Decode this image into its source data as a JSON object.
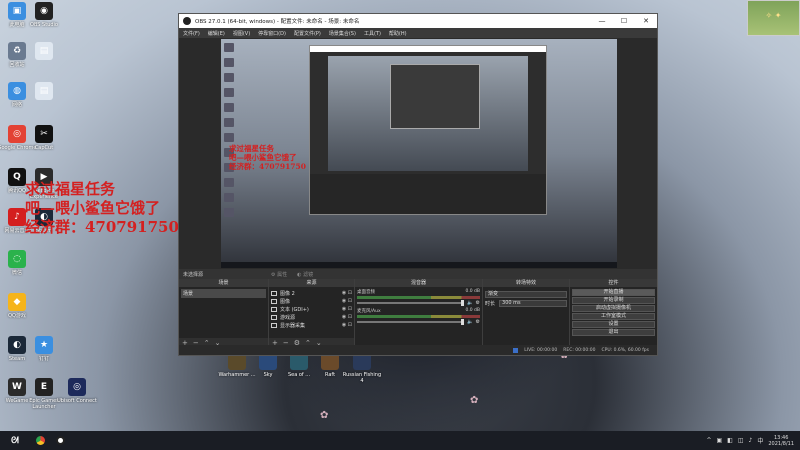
{
  "desktop": {
    "icons": [
      {
        "id": "this-pc",
        "label": "此电脑",
        "color": "#3b8fe0",
        "glyph": "▣"
      },
      {
        "id": "obs-studio",
        "label": "OBS Studio",
        "color": "#222",
        "glyph": "◉"
      },
      {
        "id": "recycle",
        "label": "回收站",
        "color": "#6a7a90",
        "glyph": "♻"
      },
      {
        "id": "file1",
        "label": "",
        "color": "#dfe7f0",
        "glyph": "▤"
      },
      {
        "id": "network",
        "label": "网络",
        "color": "#3b8fe0",
        "glyph": "◍"
      },
      {
        "id": "file2",
        "label": "",
        "color": "#dfe7f0",
        "glyph": "▤"
      },
      {
        "id": "chrome",
        "label": "Google Chrome",
        "color": "#e34234",
        "glyph": "◎"
      },
      {
        "id": "capcut",
        "label": "CapCut",
        "color": "#111",
        "glyph": "✂"
      },
      {
        "id": "qq",
        "label": "腾讯QQ",
        "color": "#111",
        "glyph": "Q"
      },
      {
        "id": "geforce",
        "label": "GeForce Experience",
        "color": "#2b2b2b",
        "glyph": "▶"
      },
      {
        "id": "netease",
        "label": "网易云音乐",
        "color": "#d41f1f",
        "glyph": "♪"
      },
      {
        "id": "steam-ico",
        "label": "Steam",
        "color": "#1b2838",
        "glyph": "◐"
      },
      {
        "id": "wechat",
        "label": "微信",
        "color": "#2bb24c",
        "glyph": "◌"
      },
      {
        "id": "qqgame",
        "label": "QQ游戏",
        "color": "#f5b41a",
        "glyph": "◆"
      },
      {
        "id": "steam",
        "label": "Steam",
        "color": "#1b2838",
        "glyph": "◐"
      },
      {
        "id": "dingtalk",
        "label": "钉钉",
        "color": "#3b8fe0",
        "glyph": "★"
      },
      {
        "id": "wegame",
        "label": "WeGame",
        "color": "#2b2b2b",
        "glyph": "W"
      },
      {
        "id": "epic",
        "label": "Epic Games Launcher",
        "color": "#222",
        "glyph": "E"
      },
      {
        "id": "ubisoft",
        "label": "Ubisoft Connect",
        "color": "#1d2a5b",
        "glyph": "◎"
      }
    ],
    "bottom_icons": [
      {
        "id": "warhammer",
        "label": "Warhammer ...",
        "color": "#5a4a2a"
      },
      {
        "id": "sky",
        "label": "Sky",
        "color": "#2a4a7a"
      },
      {
        "id": "seablue",
        "label": "Sea of ...",
        "color": "#2a5a6a"
      },
      {
        "id": "raft",
        "label": "Raft",
        "color": "#6a4a2a"
      },
      {
        "id": "russian-fishing",
        "label": "Russian Fishing 4",
        "color": "#2a3a5a"
      }
    ],
    "overlay_lines": [
      "求过福星任务",
      "吧—喂小鲨鱼它饿了",
      "经济群：470791750"
    ]
  },
  "obs": {
    "title": "OBS 27.0.1 (64-bit, windows) - 配置文件: 未命名 - 场景: 未命名",
    "menu": [
      "文件(F)",
      "编辑(E)",
      "视图(V)",
      "停靠窗口(D)",
      "配置文件(P)",
      "场景集合(S)",
      "工具(T)",
      "帮助(H)"
    ],
    "preview_text": [
      "求过福星任务",
      "吧—喂小鲨鱼它饿了",
      "经济群：470791750"
    ],
    "scene_bar_label": "未选择源",
    "scene_bar_buttons": [
      "属性",
      "滤镜"
    ],
    "docks": {
      "scenes": {
        "title": "场景",
        "items": [
          "场景"
        ]
      },
      "sources": {
        "title": "来源",
        "items": [
          {
            "name": "图像 2"
          },
          {
            "name": "图像"
          },
          {
            "name": "文本 (GDI+)"
          },
          {
            "name": "游戏源"
          },
          {
            "name": "显示器采集"
          }
        ]
      },
      "mixer": {
        "title": "混音器",
        "items": [
          {
            "name": "桌面音频",
            "db": "0.0 dB"
          },
          {
            "name": "麦克风/Aux",
            "db": "0.0 dB"
          }
        ]
      },
      "transitions": {
        "title": "转场特效",
        "type": "渐变",
        "duration_label": "时长",
        "duration": "300 ms"
      },
      "controls": {
        "title": "控件",
        "buttons": [
          "开始直播",
          "开始录制",
          "启动虚拟摄像机",
          "工作室模式",
          "设置",
          "退出"
        ]
      }
    },
    "status": {
      "live": "LIVE: 00:00:00",
      "rec": "REC: 00:00:00",
      "cpu": "CPU: 0.6%, 60.00 fps"
    }
  },
  "taskbar": {
    "start": "ᘛ",
    "time": "13:46",
    "date": "2021/8/11",
    "tray": [
      "^",
      "▣",
      "◧",
      "◫",
      "♪",
      "中"
    ]
  },
  "colors": {
    "accent": "#3b6fc8",
    "overlay_text": "#d42020"
  }
}
